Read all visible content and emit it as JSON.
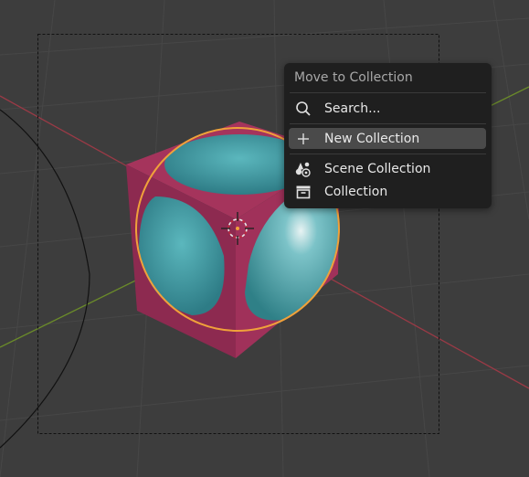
{
  "menu": {
    "title": "Move to Collection",
    "search_label": "Search...",
    "new_collection_label": "New Collection",
    "scene_collection_label": "Scene Collection",
    "collection_label": "Collection"
  },
  "colors": {
    "viewport_bg": "#3d3d3d",
    "grid": "#474747",
    "axis_x": "#9a3a46",
    "axis_y": "#6a8a2a",
    "cube": "#9c2f55",
    "sphere_teal": "#3f97a0",
    "selection_outline": "#f0a13a",
    "menu_bg": "#1f1f1f",
    "menu_highlight": "#4a4a4a"
  },
  "icons": {
    "search": "search-icon",
    "add": "plus-icon",
    "scene": "scene-collection-icon",
    "collection": "collection-box-icon"
  }
}
